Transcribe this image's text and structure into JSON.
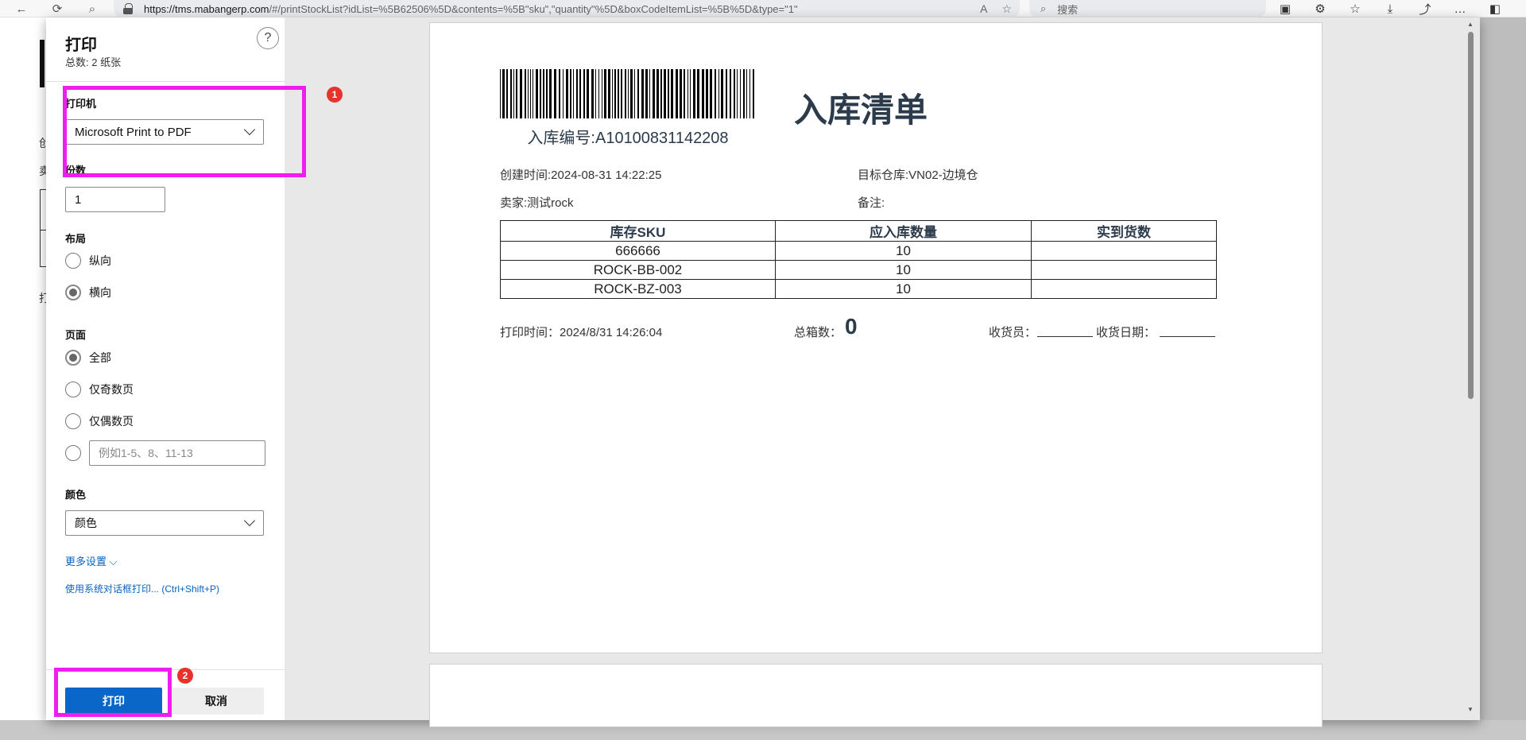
{
  "browser": {
    "url_host": "https://tms.mabangerp.com",
    "url_path": "/#/printStockList?idList=%5B62506%5D&contents=%5B\"sku\",\"quantity\"%5D&boxCodeItemList=%5B%5D&type=\"1\"",
    "search_placeholder": "搜索",
    "back_icon": "←",
    "refresh_icon": "⟳",
    "search_icon": "⌕",
    "readaloud_icon": "A",
    "favorite_icon": "☆",
    "tb_icons": [
      "▣",
      "⚙",
      "☆",
      "⤓",
      "⤴",
      "…",
      "◧"
    ]
  },
  "print_dialog": {
    "title": "打印",
    "subtitle": "总数: 2 纸张",
    "help_icon": "?",
    "printer_label": "打印机",
    "printer_value": "Microsoft Print to PDF",
    "copies_label": "份数",
    "copies_value": "1",
    "layout_label": "布局",
    "layout_portrait": "纵向",
    "layout_landscape": "横向",
    "pages_label": "页面",
    "pages_all": "全部",
    "pages_odd": "仅奇数页",
    "pages_even": "仅偶数页",
    "pages_custom_placeholder": "例如1-5、8、11-13",
    "color_label": "颜色",
    "color_value": "颜色",
    "more_settings": "更多设置 ⌵",
    "system_dialog": "使用系统对话框打印... (Ctrl+Shift+P)",
    "print_button": "打印",
    "cancel_button": "取消"
  },
  "annotations": {
    "badge1": "1",
    "badge2": "2",
    "color": "#ee1fee"
  },
  "document": {
    "title": "入库清单",
    "stock_number": "入库编号:A10100831142208",
    "created_at": "创建时间:2024-08-31 14:22:25",
    "target_warehouse": "目标仓库:VN02-边境仓",
    "seller": "卖家:测试rock",
    "remark": "备注:",
    "table_headers": [
      "库存SKU",
      "应入库数量",
      "实到货数"
    ],
    "rows": [
      [
        "666666",
        "10",
        ""
      ],
      [
        "ROCK-BB-002",
        "10",
        ""
      ],
      [
        "ROCK-BZ-003",
        "10",
        ""
      ]
    ],
    "print_time": "打印时间：2024/8/31 14:26:04",
    "box_count_label": "总箱数：",
    "box_count_value": "0",
    "receiver_label": "收货员：",
    "receive_date_label": "收货日期："
  },
  "underlying_page": {
    "fragments": [
      "创",
      "卖",
      "打"
    ]
  }
}
